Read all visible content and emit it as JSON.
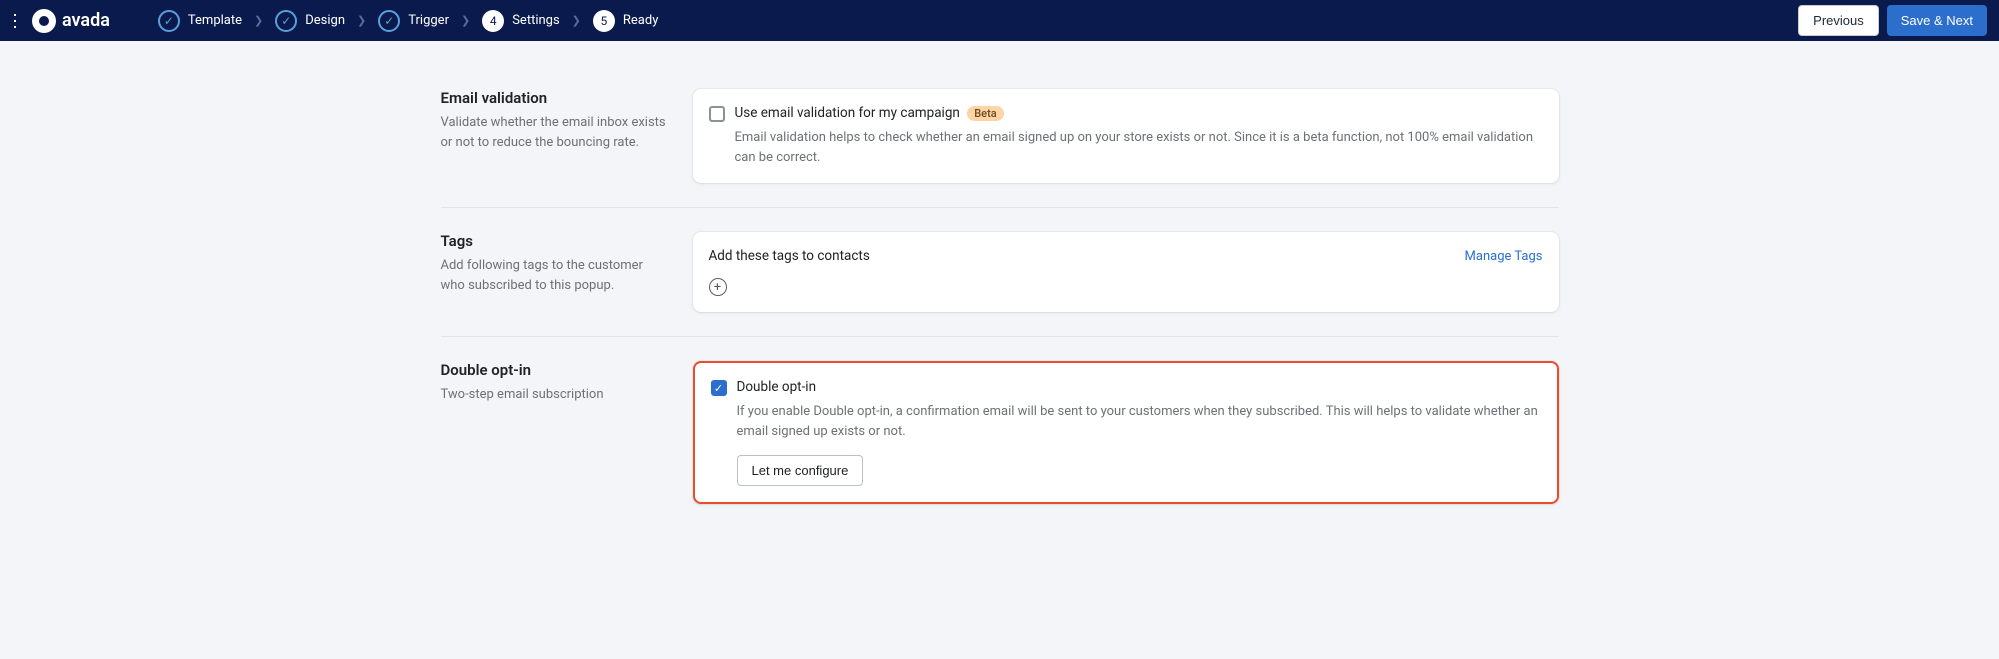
{
  "brand": "avada",
  "steps": [
    {
      "label": "Template",
      "state": "done"
    },
    {
      "label": "Design",
      "state": "done"
    },
    {
      "label": "Trigger",
      "state": "done"
    },
    {
      "label": "Settings",
      "num": "4"
    },
    {
      "label": "Ready",
      "num": "5"
    }
  ],
  "buttons": {
    "previous": "Previous",
    "save_next": "Save & Next"
  },
  "sections": {
    "email_validation": {
      "title": "Email validation",
      "desc": "Validate whether the email inbox exists or not to reduce the bouncing rate.",
      "checkbox_label": "Use email validation for my campaign",
      "badge": "Beta",
      "card_desc": "Email validation helps to check whether an email signed up on your store exists or not. Since it is a beta function, not 100% email validation can be correct."
    },
    "tags": {
      "title": "Tags",
      "desc": "Add following tags to the customer who subscribed to this popup.",
      "header": "Add these tags to contacts",
      "manage": "Manage Tags"
    },
    "double_opt_in": {
      "title": "Double opt-in",
      "desc": "Two-step email subscription",
      "checkbox_label": "Double opt-in",
      "card_desc": "If you enable Double opt-in, a confirmation email will be sent to your customers when they subscribed. This will helps to validate whether an email signed up exists or not.",
      "configure": "Let me configure"
    }
  }
}
